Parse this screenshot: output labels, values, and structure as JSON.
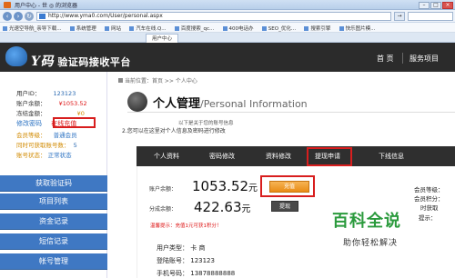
{
  "browser": {
    "window_title": "用户中心 - 世 ◎ 的浏览器",
    "url": "http://www.yma0.com/User/personal.aspx",
    "go_label": "→",
    "favorites": [
      "光速空导航_亲导下载...",
      "系统管理",
      "网站",
      "汽车在线.Q...",
      "百度搜索_qc...",
      "400电话办",
      "SEO_优化...",
      "搜索引擎",
      "快乐图片模..."
    ],
    "tabs": [
      "用户中心"
    ]
  },
  "header": {
    "brand_letter": "Y码",
    "brand_text": "验证码接收平台",
    "nav": [
      "首 页",
      "服务项目"
    ]
  },
  "left": {
    "user_id_label": "用户ID：",
    "user_id": "123123",
    "balance_label": "账户余额：",
    "balance": "¥1053.52",
    "frozen_label": "冻结金额：",
    "frozen": "¥0",
    "edit_pwd": "修改密码",
    "recharge": "在线充值",
    "member_level_label": "会员等级：",
    "member_level": "普通会员",
    "can_get_label": "同时可获取账号数：",
    "can_get": "5",
    "status_label": "账号状态：",
    "status": "正常状态",
    "menu": [
      "获取验证码",
      "项目列表",
      "资金记录",
      "短信记录",
      "帐号管理"
    ]
  },
  "main": {
    "breadcrumb": "当前位置：首页 >> 个人中心",
    "title": "个人管理",
    "title_en": "/Personal Information",
    "note_top": "以下是关于您的账号信息",
    "note": "2.您可以在这里对个人信息及密码进行修改",
    "tabs": [
      "个人资料",
      "密码修改",
      "资料修改",
      "提现申请",
      "下线信息"
    ],
    "balance_label": "账户余额：",
    "balance": "1053.52",
    "yuan": "元",
    "share_label": "分成余额：",
    "share": "422.63",
    "recharge_btn": "充值",
    "withdraw_btn": "提现",
    "warning": "温馨提示：充值1元可获1积分！",
    "user_type_label": "用户类型：",
    "user_type": "卡 商",
    "login_label": "登陆账号：",
    "login": "123123",
    "phone_label": "手机号码：",
    "phone": "13878888888",
    "right_items": [
      "会员等级：",
      "会员积分：",
      "时获取",
      "提示："
    ]
  },
  "watermark": {
    "line1": "百科全说",
    "line2": "助你轻松解决"
  },
  "colors": {
    "header_bg": "#2b2b2b",
    "menu_blue": "#3f78c3",
    "highlight_red": "#d81e1e",
    "recharge_orange": "#e98c15",
    "watermark_green": "#2a9a3c"
  }
}
